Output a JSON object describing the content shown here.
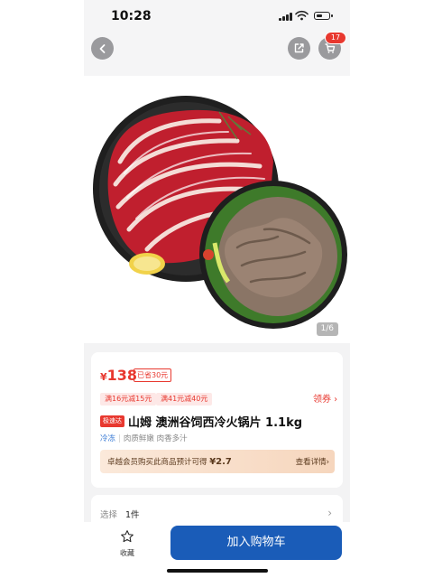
{
  "status_bar": {
    "time": "10:28"
  },
  "nav": {
    "cart_badge": "17"
  },
  "gallery": {
    "counter": "1/6"
  },
  "product": {
    "price_symbol": "¥",
    "price": "138",
    "saved": "已省30元",
    "promotions": [
      "满16元减15元",
      "满41元减40元"
    ],
    "coupon": "领券 ›",
    "express_badge": "极速达",
    "title": "山姆 澳洲谷饲西冷火锅片 1.1kg",
    "storage": "冷冻",
    "attributes": [
      "肉质鲜嫩",
      "肉香多汁"
    ],
    "member_text": "卓越会员购买此商品预计可得",
    "member_amount": "¥2.7",
    "member_detail": "查看详情›"
  },
  "select": {
    "label": "选择",
    "value": "1件",
    "chevron": "›"
  },
  "bottom": {
    "favorite_label": "收藏",
    "add_cart_label": "加入购物车"
  },
  "icons": [
    "back-arrow-icon",
    "share-icon",
    "cart-icon",
    "star-icon",
    "signal-icon",
    "wifi-icon",
    "battery-icon"
  ],
  "colors": {
    "accent_red": "#e8382f",
    "primary_blue": "#1a5cb8"
  }
}
